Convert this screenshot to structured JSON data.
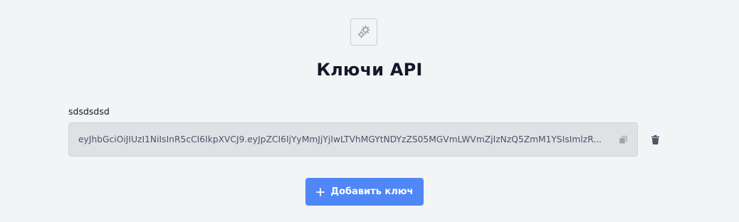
{
  "header": {
    "icon": "gears-icon",
    "title": "Ключи API"
  },
  "api_key": {
    "name": "sdsdsdsd",
    "value": "eyJhbGciOiJIUzI1NiIsInR5cCI6IkpXVCJ9.eyJpZCI6IjYyMmJjYjIwLTVhMGYtNDYzZS05MGVmLWVmZjIzNzQ5ZmM1YSIsImlzR...",
    "copy_icon": "copy-icon",
    "delete_icon": "trash-icon"
  },
  "actions": {
    "add_label": "Добавить ключ",
    "add_icon": "plus-icon"
  },
  "colors": {
    "background": "#f3f4f6",
    "primary": "#4f87f7",
    "field_bg": "#dfe1e5",
    "icon_muted": "#4b5563"
  }
}
